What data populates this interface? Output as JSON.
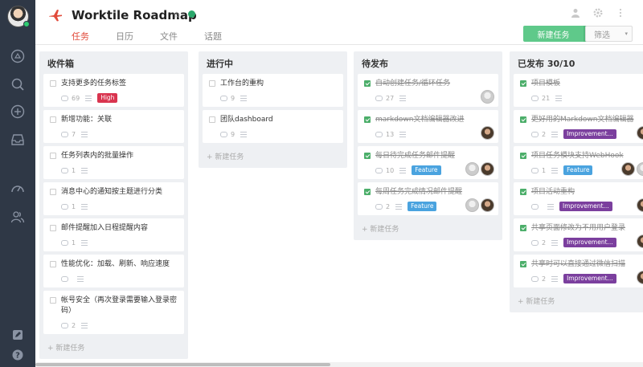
{
  "header": {
    "title": "Worktile Roadmap",
    "tabs": [
      {
        "label": "任务",
        "active": true
      },
      {
        "label": "日历"
      },
      {
        "label": "文件"
      },
      {
        "label": "话题"
      }
    ],
    "new_task_label": "新建任务",
    "filter_label": "筛选",
    "accent_color": "#e14b3b"
  },
  "board": {
    "add_task_label": "+ 新建任务",
    "columns": [
      {
        "title": "收件箱",
        "cards": [
          {
            "text": "支持更多的任务标签",
            "comments": "69",
            "tag": "High",
            "tag_type": "high"
          },
          {
            "text": "新增功能：关联",
            "comments": "7"
          },
          {
            "text": "任务列表内的批量操作",
            "comments": "1"
          },
          {
            "text": "消息中心的通知按主题进行分类",
            "comments": "1"
          },
          {
            "text": "邮件提醒加入日程提醒内容",
            "comments": "1"
          },
          {
            "text": "性能优化：加载、刷新、响应速度",
            "comments": ""
          },
          {
            "text": "帐号安全（再次登录需要输入登录密码）",
            "comments": "2"
          }
        ]
      },
      {
        "title": "进行中",
        "cards": [
          {
            "text": "工作台的重构",
            "comments": "9"
          },
          {
            "text": "团队dashboard",
            "comments": "9"
          }
        ]
      },
      {
        "title": "待发布",
        "cards": [
          {
            "text": "自动创建任务/循环任务",
            "comments": "27",
            "done": true,
            "avatars": [
              "light"
            ]
          },
          {
            "text": "markdown文档编辑器改进",
            "comments": "13",
            "done": true,
            "avatars": [
              "dark"
            ]
          },
          {
            "text": "每日待完成任务邮件提醒",
            "comments": "10",
            "done": true,
            "tag": "Feature",
            "tag_type": "feature",
            "avatars": [
              "light",
              "dark"
            ]
          },
          {
            "text": "每周任务完成情况邮件提醒",
            "comments": "2",
            "done": true,
            "tag": "Feature",
            "tag_type": "feature",
            "avatars": [
              "light",
              "dark"
            ]
          }
        ]
      },
      {
        "title": "已发布 30/10",
        "cards": [
          {
            "text": "项目模板",
            "comments": "21",
            "done": true
          },
          {
            "text": "更好用的Markdown文档编辑器",
            "comments": "2",
            "done": true,
            "tag": "Improvement...",
            "tag_type": "improve",
            "avatars": [
              "dark"
            ]
          },
          {
            "text": "项目任务模块支持WebHook",
            "comments": "1",
            "done": true,
            "tag": "Feature",
            "tag_type": "feature",
            "avatars": [
              "dark",
              "light"
            ]
          },
          {
            "text": "项目活动重构",
            "comments": "",
            "done": true,
            "tag": "Improvement...",
            "tag_type": "improve",
            "avatars": [
              "dark"
            ]
          },
          {
            "text": "共享页面修改为不用用户登录",
            "comments": "2",
            "done": true,
            "tag": "Improvement...",
            "tag_type": "improve",
            "avatars": [
              "dark"
            ]
          },
          {
            "text": "共享时可以直接通过微信扫描",
            "comments": "2",
            "done": true,
            "tag": "Improvement...",
            "tag_type": "improve",
            "avatars": [
              "dark"
            ]
          }
        ]
      }
    ]
  }
}
